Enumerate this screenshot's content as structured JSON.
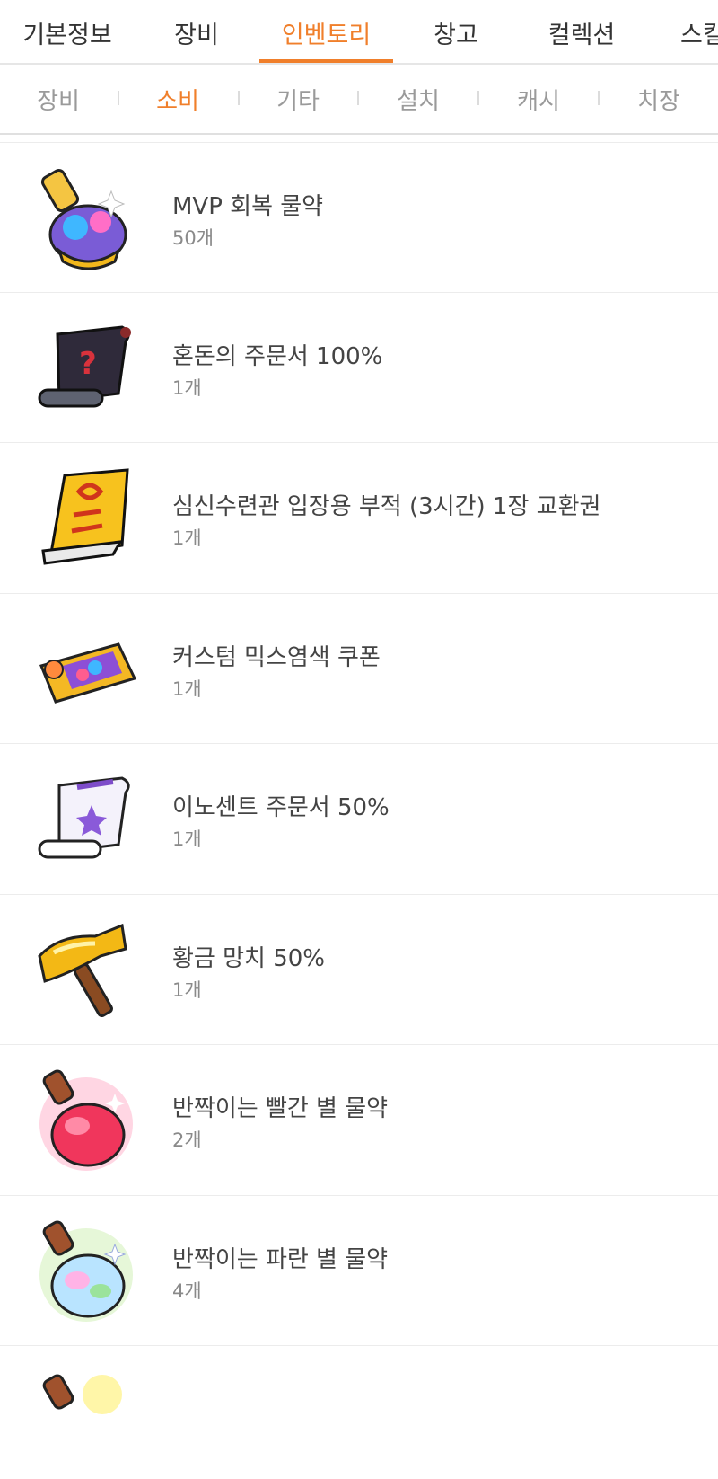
{
  "tabs": [
    {
      "label": "기본정보"
    },
    {
      "label": "장비"
    },
    {
      "label": "인벤토리"
    },
    {
      "label": "창고"
    },
    {
      "label": "컬렉션"
    },
    {
      "label": "스킬"
    }
  ],
  "active_tab": "인벤토리",
  "subtabs": [
    {
      "label": "장비"
    },
    {
      "label": "소비"
    },
    {
      "label": "기타"
    },
    {
      "label": "설치"
    },
    {
      "label": "캐시"
    },
    {
      "label": "치장"
    }
  ],
  "active_subtab": "소비",
  "accent_color": "#f07f2b",
  "items": [
    {
      "name": "MVP 회복 물약",
      "count": "50개",
      "icon": "mvp-potion-icon"
    },
    {
      "name": "혼돈의 주문서 100%",
      "count": "1개",
      "icon": "chaos-scroll-icon"
    },
    {
      "name": "심신수련관 입장용 부적 (3시간) 1장 교환권",
      "count": "1개",
      "icon": "talisman-icon"
    },
    {
      "name": "커스텀 믹스염색 쿠폰",
      "count": "1개",
      "icon": "dye-coupon-icon"
    },
    {
      "name": "이노센트 주문서 50%",
      "count": "1개",
      "icon": "innocent-scroll-icon"
    },
    {
      "name": "황금 망치 50%",
      "count": "1개",
      "icon": "golden-hammer-icon"
    },
    {
      "name": "반짝이는 빨간 별 물약",
      "count": "2개",
      "icon": "red-star-potion-icon"
    },
    {
      "name": "반짝이는 파란 별 물약",
      "count": "4개",
      "icon": "blue-star-potion-icon"
    }
  ]
}
